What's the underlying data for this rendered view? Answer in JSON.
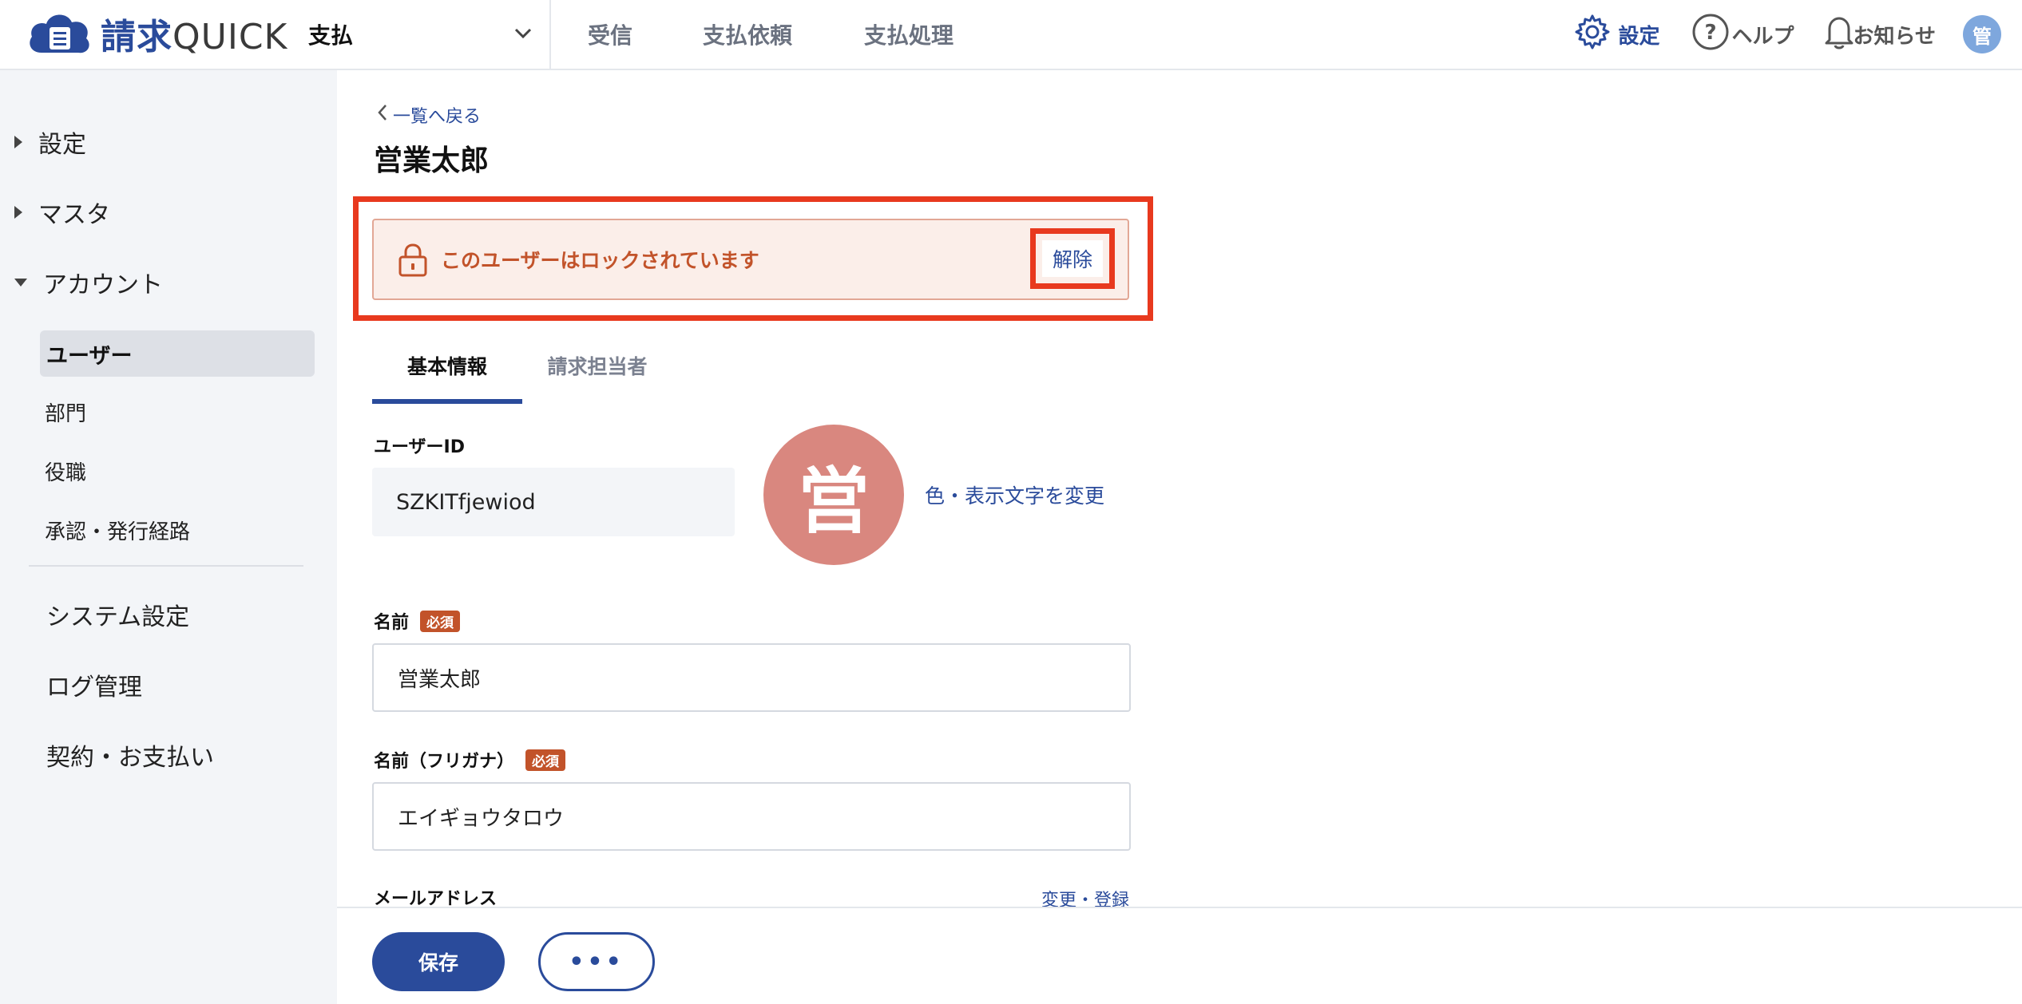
{
  "header": {
    "logo_prefix": "請求",
    "logo_suffix": "QUICK",
    "module": "支払",
    "nav": [
      "受信",
      "支払依頼",
      "支払処理"
    ],
    "settings_label": "設定",
    "help_label": "ヘルプ",
    "notifications_label": "お知らせ",
    "avatar_initial": "管"
  },
  "sidebar": {
    "groups": [
      "設定",
      "マスタ",
      "アカウント"
    ],
    "account_items": [
      "ユーザー",
      "部門",
      "役職",
      "承認・発行経路"
    ],
    "bottom_items": [
      "システム設定",
      "ログ管理",
      "契約・お支払い"
    ]
  },
  "page": {
    "back_link": "一覧へ戻る",
    "title": "営業太郎",
    "lock_message": "このユーザーはロックされています",
    "unlock_button": "解除",
    "tabs": [
      "基本情報",
      "請求担当者"
    ]
  },
  "form": {
    "user_id_label": "ユーザーID",
    "user_id_value": "SZKITfjewiod",
    "avatar_char": "営",
    "change_avatar_link": "色・表示文字を変更",
    "name_label": "名前",
    "required_badge": "必須",
    "name_value": "営業太郎",
    "kana_label": "名前（フリガナ）",
    "kana_value": "エイギョウタロウ",
    "email_label": "メールアドレス",
    "email_change_link": "変更・登録"
  },
  "footer": {
    "save_button": "保存",
    "more_button": "•••"
  },
  "colors": {
    "brand": "#2a4b9b",
    "warning": "#c2532a",
    "highlight": "#e8391e",
    "avatar": "#d9877f"
  }
}
